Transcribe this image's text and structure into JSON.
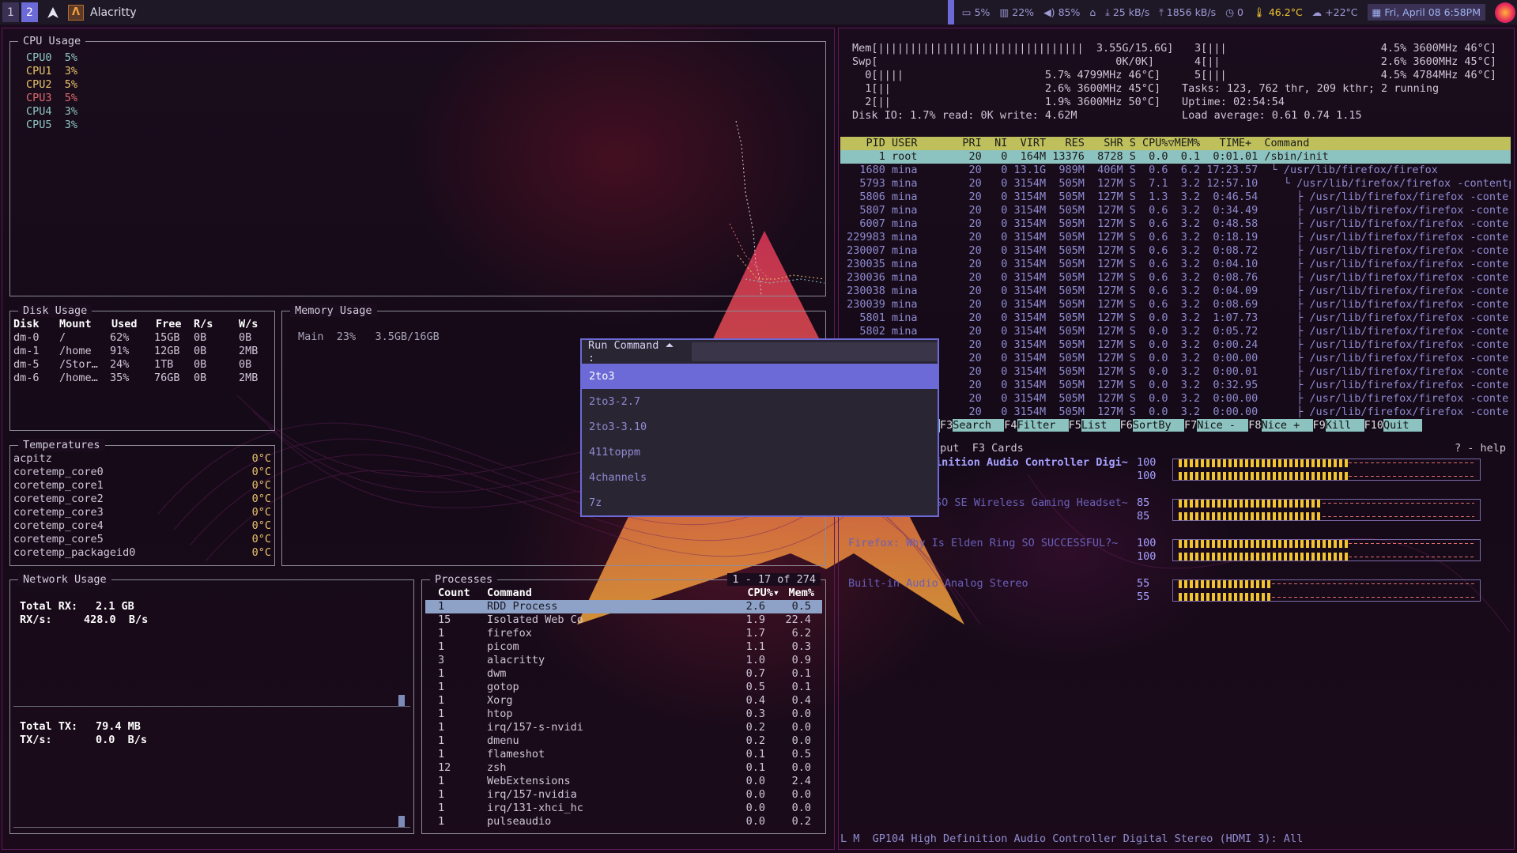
{
  "topbar": {
    "workspaces": [
      "1",
      "2"
    ],
    "window_title": "Alacritty",
    "tray": {
      "cpu": "5%",
      "memory": "22%",
      "volume": "85%",
      "net_down": "25 kB/s",
      "net_up": "1856 kB/s",
      "count": "0",
      "cpu_temp": "46.2°C",
      "weather": "+22°C",
      "clock": "Fri, April 08 6:58PM"
    },
    "icons": [
      "arch-logo-icon",
      "terminal-icon",
      "monitor-icon",
      "memory-icon",
      "volume-icon",
      "network-icon",
      "download-icon",
      "upload-icon",
      "timer-icon",
      "thermometer-icon",
      "weather-icon",
      "calendar-icon",
      "firefox-icon"
    ]
  },
  "cpu_panel": {
    "title": "CPU Usage",
    "cores": [
      {
        "name": "CPU0",
        "value": "5%",
        "color": "#8ec7c3"
      },
      {
        "name": "CPU1",
        "value": "3%",
        "color": "#e9c46a"
      },
      {
        "name": "CPU2",
        "value": "5%",
        "color": "#e9c46a"
      },
      {
        "name": "CPU3",
        "value": "5%",
        "color": "#e06c6c"
      },
      {
        "name": "CPU4",
        "value": "3%",
        "color": "#8ec7c3"
      },
      {
        "name": "CPU5",
        "value": "3%",
        "color": "#8ec7c3"
      }
    ]
  },
  "disk_panel": {
    "title": "Disk Usage",
    "headers": [
      "Disk",
      "Mount",
      "Used",
      "Free",
      "R/s",
      "W/s"
    ],
    "rows": [
      [
        "dm-0",
        "/",
        "62%",
        "15GB",
        "0B",
        "0B"
      ],
      [
        "dm-1",
        "/home",
        "91%",
        "12GB",
        "0B",
        "2MB"
      ],
      [
        "dm-5",
        "/Stor…",
        "24%",
        "1TB",
        "0B",
        "0B"
      ],
      [
        "dm-6",
        "/home…",
        "35%",
        "76GB",
        "0B",
        "2MB"
      ]
    ]
  },
  "memory_panel": {
    "title": "Memory Usage",
    "line": "Main  23%   3.5GB/16GB"
  },
  "temp_panel": {
    "title": "Temperatures",
    "rows": [
      [
        "acpitz",
        "0°C"
      ],
      [
        "coretemp_core0",
        "0°C"
      ],
      [
        "coretemp_core1",
        "0°C"
      ],
      [
        "coretemp_core2",
        "0°C"
      ],
      [
        "coretemp_core3",
        "0°C"
      ],
      [
        "coretemp_core4",
        "0°C"
      ],
      [
        "coretemp_core5",
        "0°C"
      ],
      [
        "coretemp_packageid0",
        "0°C"
      ]
    ]
  },
  "network_panel": {
    "title": "Network Usage",
    "rx_total_label": "Total RX:",
    "rx_total": "2.1 GB",
    "rx_rate_label": "RX/s:",
    "rx_rate": "428.0  B/s",
    "tx_total_label": "Total TX:",
    "tx_total": "79.4 MB",
    "tx_rate_label": "TX/s:",
    "tx_rate": "0.0  B/s"
  },
  "process_panel": {
    "title": "Processes",
    "range": "1 - 17 of 274",
    "headers": [
      "Count",
      "Command",
      "CPU%▾",
      "Mem%"
    ],
    "rows": [
      [
        "1",
        "RDD Process",
        "2.6",
        "0.5"
      ],
      [
        "15",
        "Isolated Web Co",
        "1.9",
        "22.4"
      ],
      [
        "1",
        "firefox",
        "1.7",
        "6.2"
      ],
      [
        "1",
        "picom",
        "1.1",
        "0.3"
      ],
      [
        "3",
        "alacritty",
        "1.0",
        "0.9"
      ],
      [
        "1",
        "dwm",
        "0.7",
        "0.1"
      ],
      [
        "1",
        "gotop",
        "0.5",
        "0.1"
      ],
      [
        "1",
        "Xorg",
        "0.4",
        "0.4"
      ],
      [
        "1",
        "htop",
        "0.3",
        "0.0"
      ],
      [
        "1",
        "irq/157-s-nvidi",
        "0.2",
        "0.0"
      ],
      [
        "1",
        "dmenu",
        "0.2",
        "0.0"
      ],
      [
        "1",
        "flameshot",
        "0.1",
        "0.5"
      ],
      [
        "12",
        "zsh",
        "0.1",
        "0.0"
      ],
      [
        "1",
        "WebExtensions",
        "0.0",
        "2.4"
      ],
      [
        "1",
        "irq/157-nvidia",
        "0.0",
        "0.0"
      ],
      [
        "1",
        "irq/131-xhci_hc",
        "0.0",
        "0.0"
      ],
      [
        "1",
        "pulseaudio",
        "0.0",
        "0.2"
      ]
    ]
  },
  "htop": {
    "mem_line": "Mem[||||||||||||||||||||||||||||||||  3.55G/15.6G]",
    "swp_line": "Swp[                                     0K/0K]",
    "cpu_lines": [
      "  0[||||                      5.7% 4799MHz 46°C]",
      "  1[||                        2.6% 3600MHz 45°C]",
      "  2[||                        1.9% 3600MHz 50°C]"
    ],
    "cpu_lines_right": [
      "3[|||                        4.5% 3600MHz 46°C]",
      "4[||                         2.6% 3600MHz 45°C]",
      "5[|||                        4.5% 4784MHz 46°C]"
    ],
    "tasks": "Tasks: 123, 762 thr, 209 kthr; 2 running",
    "uptime": "Uptime: 02:54:54",
    "disk_io": "Disk IO: 1.7% read: 0K write: 4.62M",
    "load": "Load average: 0.61 0.74 1.15",
    "header": "    PID USER       PRI  NI  VIRT   RES   SHR S CPU%▽MEM%   TIME+  Command",
    "rows": [
      "      1 root        20   0  164M 13376  8728 S  0.0  0.1  0:01.01 /sbin/init",
      "   1680 mina        20   0 13.1G  989M  406M S  0.6  6.2 17:23.57  └ /usr/lib/firefox/firefox",
      "   5793 mina        20   0 3154M  505M  127M S  7.1  3.2 12:57.10    └ /usr/lib/firefox/firefox -contentp",
      "   5806 mina        20   0 3154M  505M  127M S  1.3  3.2  0:46.54      ├ /usr/lib/firefox/firefox -conte",
      "   5807 mina        20   0 3154M  505M  127M S  0.6  3.2  0:34.49      ├ /usr/lib/firefox/firefox -conte",
      "   6007 mina        20   0 3154M  505M  127M S  0.6  3.2  0:48.58      ├ /usr/lib/firefox/firefox -conte",
      " 229983 mina        20   0 3154M  505M  127M S  0.6  3.2  0:18.19      ├ /usr/lib/firefox/firefox -conte",
      " 230007 mina        20   0 3154M  505M  127M S  0.6  3.2  0:08.72      ├ /usr/lib/firefox/firefox -conte",
      " 230035 mina        20   0 3154M  505M  127M S  0.6  3.2  0:04.10      ├ /usr/lib/firefox/firefox -conte",
      " 230036 mina        20   0 3154M  505M  127M S  0.6  3.2  0:08.76      ├ /usr/lib/firefox/firefox -conte",
      " 230038 mina        20   0 3154M  505M  127M S  0.6  3.2  0:04.09      ├ /usr/lib/firefox/firefox -conte",
      " 230039 mina        20   0 3154M  505M  127M S  0.6  3.2  0:08.69      ├ /usr/lib/firefox/firefox -conte",
      "   5801 mina        20   0 3154M  505M  127M S  0.0  3.2  1:07.73      ├ /usr/lib/firefox/firefox -conte",
      "   5802 mina        20   0 3154M  505M  127M S  0.0  3.2  0:05.72      ├ /usr/lib/firefox/firefox -conte",
      "                    20   0 3154M  505M  127M S  0.0  3.2  0:00.24      ├ /usr/lib/firefox/firefox -conte",
      "                    20   0 3154M  505M  127M S  0.0  3.2  0:00.00      ├ /usr/lib/firefox/firefox -conte",
      "                    20   0 3154M  505M  127M S  0.0  3.2  0:00.01      ├ /usr/lib/firefox/firefox -conte",
      "                    20   0 3154M  505M  127M S  0.0  3.2  0:32.95      ├ /usr/lib/firefox/firefox -conte",
      "                    20   0 3154M  505M  127M S  0.0  3.2  0:00.00      ├ /usr/lib/firefox/firefox -conte",
      "                    20   0 3154M  505M  127M S  0.0  3.2  0:00.00      ├ /usr/lib/firefox/firefox -conte"
    ],
    "fkeys": [
      [
        "F3",
        "Search"
      ],
      [
        "F4",
        "Filter"
      ],
      [
        "F5",
        "List"
      ],
      [
        "F6",
        "SortBy"
      ],
      [
        "F7",
        "Nice -"
      ],
      [
        "F8",
        "Nice +"
      ],
      [
        "F9",
        "Kill"
      ],
      [
        "F10",
        "Quit"
      ]
    ]
  },
  "pulsemixer": {
    "tabs": "nput  F3 Cards",
    "help": "? - help",
    "sinks": [
      {
        "name": "inition Audio Controller Digi~",
        "vols": [
          "100",
          "100"
        ],
        "levels": [
          1.0,
          1.0
        ],
        "highlight": true
      },
      {
        "name": "SO SE Wireless Gaming Headset~",
        "vols": [
          "85",
          "85"
        ],
        "levels": [
          0.85,
          0.85
        ],
        "highlight": false
      },
      {
        "name": "Firefox: Why Is Elden Ring SO SUCCESSFUL?~",
        "vols": [
          "100",
          "100"
        ],
        "levels": [
          1.0,
          1.0
        ],
        "highlight": false
      },
      {
        "name": "Built-in Audio Analog Stereo",
        "vols": [
          "55",
          "55"
        ],
        "levels": [
          0.55,
          0.55
        ],
        "highlight": false
      }
    ],
    "status": "L M  GP104 High Definition Audio Controller Digital Stereo (HDMI 3): All"
  },
  "run_command": {
    "prompt": "Run Command ⏶ :",
    "input_value": "",
    "items": [
      "2to3",
      "2to3-2.7",
      "2to3-3.10",
      "411toppm",
      "4channels",
      "7z"
    ]
  }
}
